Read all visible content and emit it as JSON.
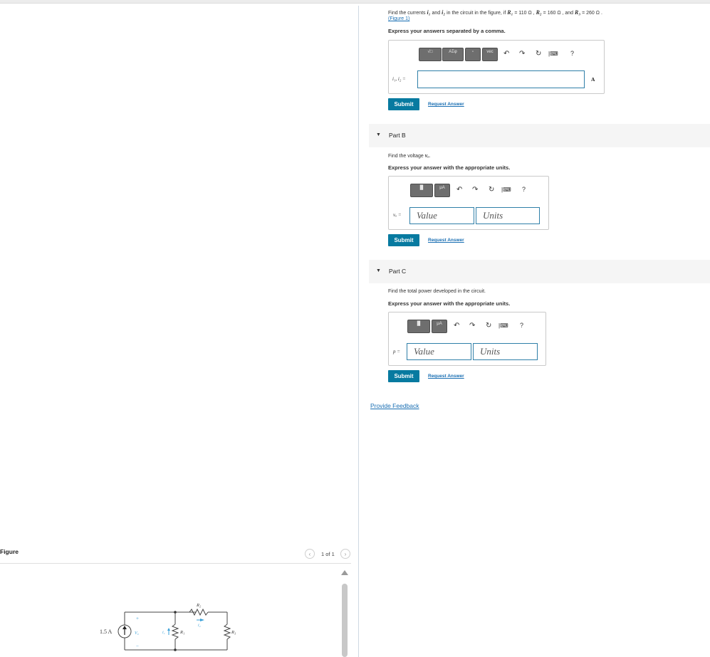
{
  "question": {
    "prompt_prefix": "Find the currents",
    "i1": "i₁",
    "and": "and",
    "i2": "i₂",
    "prompt_mid": "in the circuit in the figure, if",
    "r1_label": "R₁",
    "r1_value": "= 110 Ω ,",
    "r2_label": "R₂",
    "r2_value": "= 160 Ω ,",
    "and2": "and",
    "r3_label": "R₃",
    "r3_value": "= 260 Ω .",
    "figure_link": "(Figure 1)"
  },
  "partA": {
    "instruction": "Express your answers separated by a comma.",
    "field_label": "i₁, i₂ =",
    "unit": "A",
    "submit": "Submit",
    "request_answer": "Request Answer",
    "toolbar": {
      "templates": "√□",
      "greek": "AΣφ",
      "vec": "vec",
      "help": "?"
    }
  },
  "partB": {
    "title": "Part B",
    "prompt_prefix": "Find the voltage",
    "var": "vₒ",
    "instruction": "Express your answer with the appropriate units.",
    "field_label": "vₒ =",
    "value_placeholder": "Value",
    "units_placeholder": "Units",
    "submit": "Submit",
    "request_answer": "Request Answer",
    "toolbar": {
      "units_btn": "μA",
      "help": "?"
    }
  },
  "partC": {
    "title": "Part C",
    "prompt": "Find the total power developed in the circuit.",
    "instruction": "Express your answer with the appropriate units.",
    "field_label": "p =",
    "value_placeholder": "Value",
    "units_placeholder": "Units",
    "submit": "Submit",
    "request_answer": "Request Answer",
    "toolbar": {
      "units_btn": "μA",
      "help": "?"
    }
  },
  "feedback_link": "Provide Feedback",
  "figure": {
    "label": "Figure",
    "pager": "1 of 1",
    "source": "1.5 A",
    "v0": "V₀",
    "plus": "+",
    "minus": "−",
    "i1": "i₁",
    "i2": "i₂",
    "r1": "R₁",
    "r2": "R₂",
    "r3": "R₃"
  }
}
